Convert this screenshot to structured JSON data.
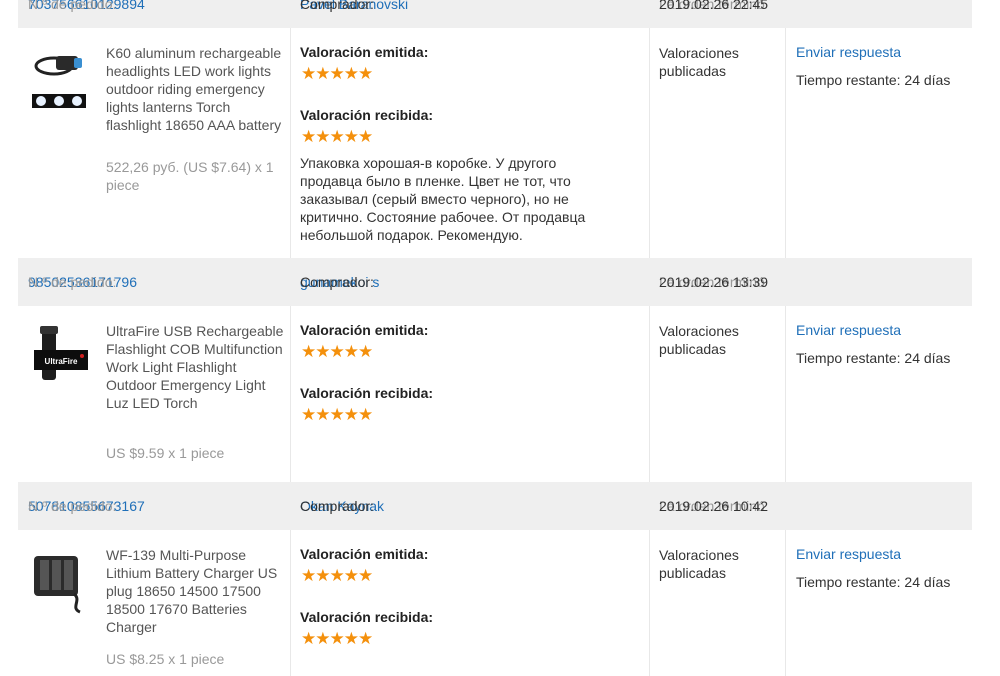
{
  "labels": {
    "order_no": "N.º de pedido:",
    "buyer": "Comprador:",
    "order_ended": "La orden terminó",
    "rating_given": "Valoración emitida:",
    "rating_received": "Valoración recibida:",
    "published": "Valoraciones publicadas",
    "reply": "Enviar respuesta",
    "time_left": "Tiempo restante: 24 días",
    "stars": "★★★★★"
  },
  "orders": [
    {
      "order_number": "703756610129894",
      "buyer": "Pavel Baranovski",
      "end_date": "2019.02.26 22:45",
      "product": "K60 aluminum rechargeable headlights LED work lights outdoor riding emergency lights lanterns Torch flashlight 18650 AAA battery",
      "price": "522,26 руб. (US $7.64) x 1 piece",
      "review": "Упаковка хорошая-в коробке. У другого продавца было в пленке. Цвет не тот, что заказывал (серый вместо черного), но не критично. Состояние рабочее. От продавца небольшой подарок. Рекомендую.",
      "thumb_icon": "headlamp-icon"
    },
    {
      "order_number": "98502536171796",
      "buyer": "gunamekoi s",
      "end_date": "2019.02.26 13:39",
      "product": "UltraFire USB Rechargeable Flashlight COB Multifunction Work Light Flashlight Outdoor Emergency Light Luz LED Torch",
      "price": "US $9.59 x 1 piece",
      "thumb_icon": "flashlight-icon",
      "thumb_text": "UltraFire"
    },
    {
      "order_number": "507810855673167",
      "buyer": "Okan Kaynak",
      "end_date": "2019.02.26 10:42",
      "product": "WF-139 Multi-Purpose Lithium Battery Charger US plug 18650 14500 17500 18500 17670 Batteries Charger",
      "price": "US $8.25 x 1 piece",
      "thumb_icon": "battery-charger-icon"
    }
  ],
  "colors": {
    "link": "#1f6fb8",
    "star": "#f4900c",
    "header_bg": "#efefef"
  }
}
